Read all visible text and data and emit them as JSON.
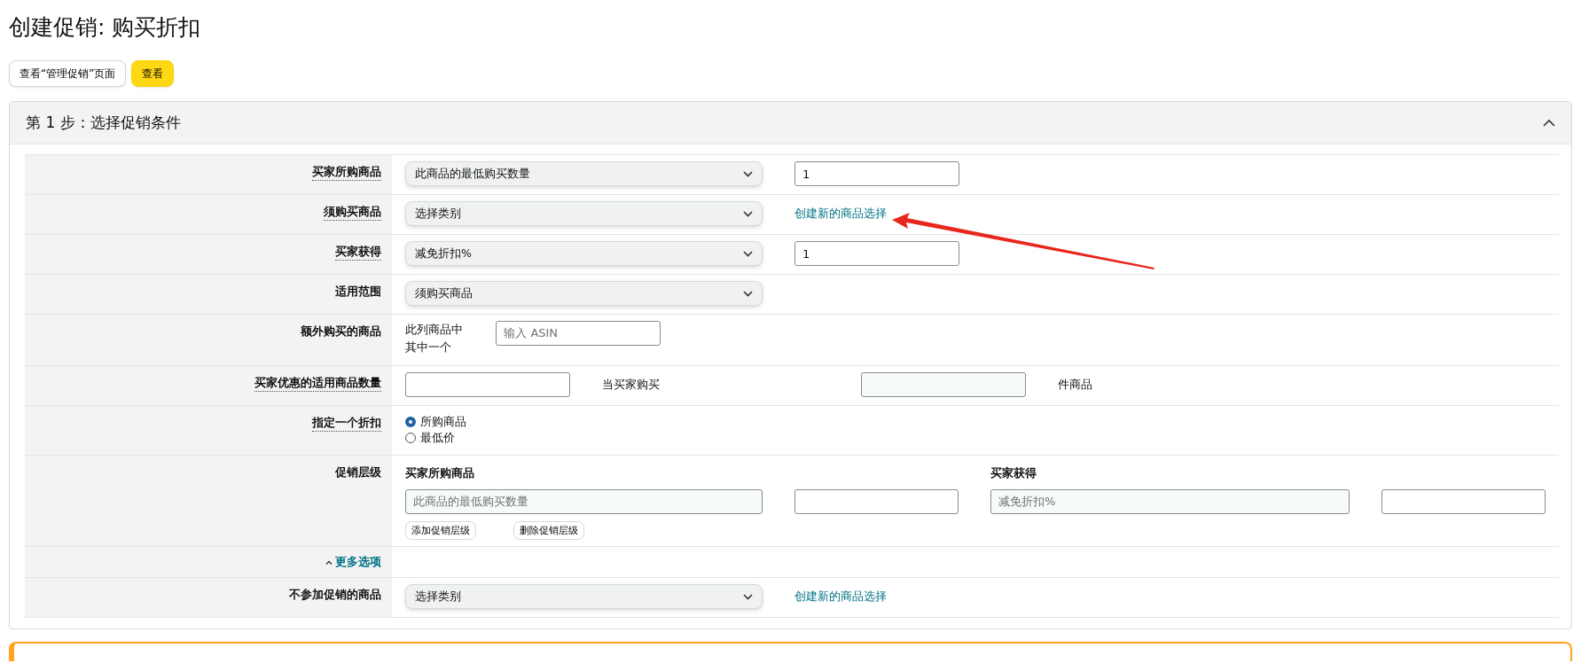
{
  "title": "创建促销: 购买折扣",
  "header_buttons": [
    {
      "label": "查看“管理促销”页面",
      "kind": "secondary"
    },
    {
      "label": "查看",
      "kind": "primary"
    }
  ],
  "step_panel": {
    "title": "第 1 步：选择促销条件",
    "expanded": true,
    "rows": [
      {
        "kind": "select_input",
        "label": "买家所购商品",
        "underlined": true,
        "select": "此商品的最低购买数量",
        "value": "1"
      },
      {
        "kind": "select_link",
        "label": "须购买商品",
        "underlined": true,
        "select": "选择类别",
        "link": "创建新的商品选择"
      },
      {
        "kind": "select_input",
        "label": "买家获得",
        "underlined": true,
        "select": "减免折扣%",
        "value": "1"
      },
      {
        "kind": "select",
        "label": "适用范围",
        "underlined": false,
        "select": "须购买商品"
      },
      {
        "kind": "asin",
        "label": "额外购买的商品",
        "underlined": false,
        "text": "此列商品中其中一个",
        "placeholder": "输入 ASIN"
      },
      {
        "kind": "quantity",
        "label": "买家优惠的适用商品数量",
        "underlined": true,
        "text_before": "当买家购买",
        "text_after": "件商品"
      },
      {
        "kind": "radio",
        "label": "指定一个折扣",
        "underlined": true,
        "options": [
          {
            "label": "所购商品",
            "selected": true
          },
          {
            "label": "最低价",
            "selected": false
          }
        ]
      },
      {
        "kind": "tiers",
        "label": "促销层级",
        "underlined": false,
        "buys_heading": "买家所购商品",
        "buys_placeholder": "此商品的最低购买数量",
        "gets_heading": "买家获得",
        "gets_placeholder": "减免折扣%",
        "buttons": [
          "添加促销层级",
          "删除促销层级"
        ]
      },
      {
        "kind": "more",
        "label": "更多选项"
      },
      {
        "kind": "select_link",
        "label": "不参加促销的商品",
        "underlined": false,
        "select": "选择类别",
        "link": "创建新的商品选择"
      }
    ]
  },
  "warning": {
    "kind": "warning"
  }
}
